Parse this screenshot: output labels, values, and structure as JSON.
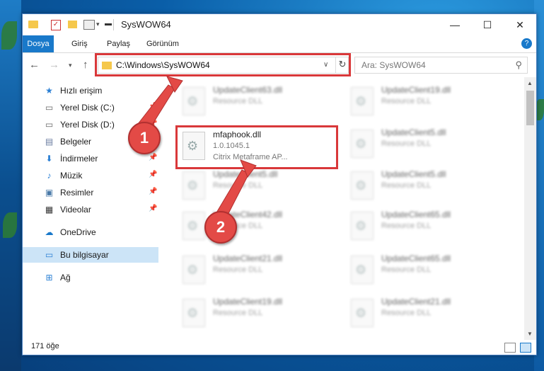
{
  "window": {
    "title": "SysWOW64",
    "controls": {
      "minimize": "—",
      "maximize": "☐",
      "close": "✕"
    }
  },
  "ribbon": {
    "tabs": [
      "Dosya",
      "Giriş",
      "Paylaş",
      "Görünüm"
    ],
    "help": "?"
  },
  "address": {
    "path": "C:\\Windows\\SysWOW64",
    "search_placeholder": "Ara: SysWOW64"
  },
  "sidebar": {
    "items": [
      {
        "label": "Hızlı erişim",
        "icon": "star-icon"
      },
      {
        "label": "Yerel Disk (C:)",
        "icon": "drive-icon"
      },
      {
        "label": "Yerel Disk (D:)",
        "icon": "drive-icon"
      },
      {
        "label": "Belgeler",
        "icon": "documents-icon"
      },
      {
        "label": "İndirmeler",
        "icon": "download-icon"
      },
      {
        "label": "Müzik",
        "icon": "music-icon"
      },
      {
        "label": "Resimler",
        "icon": "pictures-icon"
      },
      {
        "label": "Videolar",
        "icon": "videos-icon"
      },
      {
        "label": "OneDrive",
        "icon": "cloud-icon"
      },
      {
        "label": "Bu bilgisayar",
        "icon": "computer-icon"
      },
      {
        "label": "Ağ",
        "icon": "network-icon"
      }
    ],
    "selected": "Bu bilgisayar"
  },
  "files": {
    "highlighted": {
      "name": "mfaphook.dll",
      "version": "1.0.1045.1",
      "description": "Citrix Metaframe AP..."
    },
    "left_column": [
      {
        "name": "UpdateClient63.dll",
        "desc": "Resource DLL"
      },
      {
        "name": "UpdateClient5.dll",
        "desc": "Resource DLL"
      },
      {
        "name": "UpdateClient42.dll",
        "desc": "Resource DLL"
      },
      {
        "name": "UpdateClient21.dll",
        "desc": "Resource DLL"
      },
      {
        "name": "UpdateClient19.dll",
        "desc": "Resource DLL"
      }
    ],
    "right_column": [
      {
        "name": "UpdateClient19.dll",
        "desc": "Resource DLL"
      },
      {
        "name": "UpdateClient5.dll",
        "desc": "Resource DLL"
      },
      {
        "name": "UpdateClient5.dll",
        "desc": "Resource DLL"
      },
      {
        "name": "UpdateClient65.dll",
        "desc": "Resource DLL"
      },
      {
        "name": "UpdateClient65.dll",
        "desc": "Resource DLL"
      },
      {
        "name": "UpdateClient21.dll",
        "desc": "Resource DLL"
      }
    ]
  },
  "status": {
    "item_count": "171 öğe"
  },
  "annotations": {
    "step1": "1",
    "step2": "2",
    "color": "#e34a46"
  }
}
